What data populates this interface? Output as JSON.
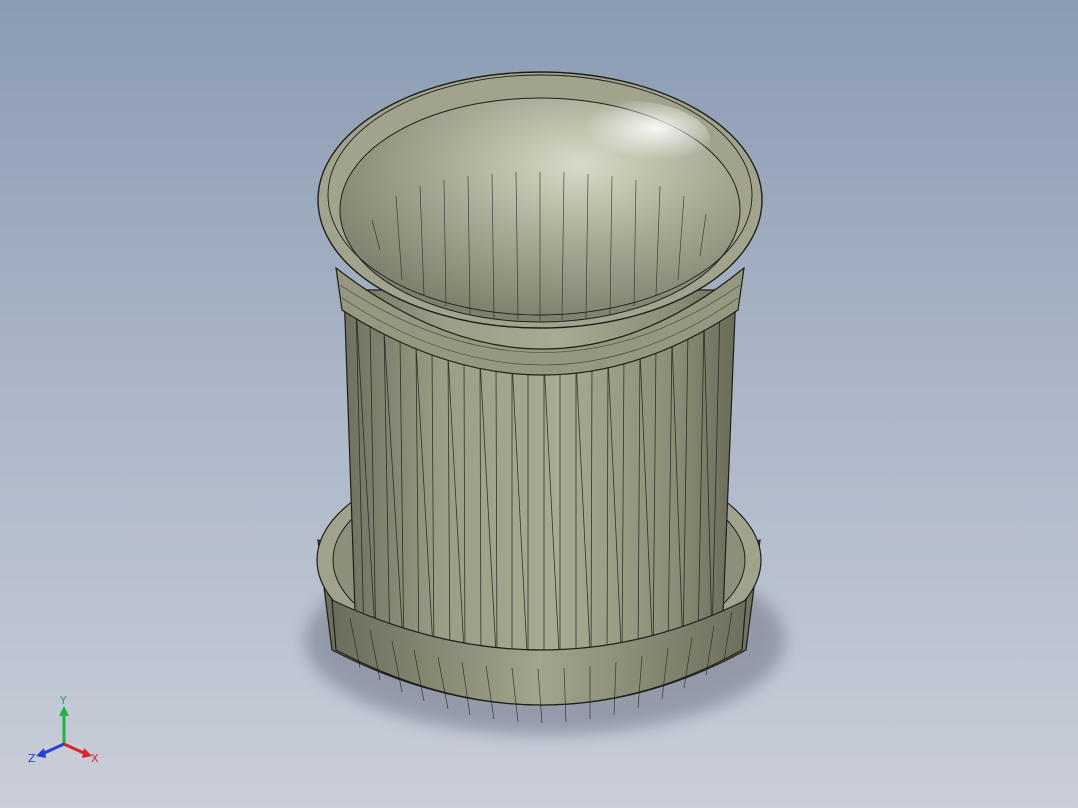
{
  "viewport": {
    "background_top": "#8a9bb2",
    "background_bottom": "#c9ced8"
  },
  "model": {
    "description_icon": "cylindrical-cup-mesh",
    "face_color": "#a4a58e",
    "edge_color": "#1e1f1a"
  },
  "triad": {
    "x_label": "X",
    "y_label": "Y",
    "z_label": "Z",
    "x_color": "#e0242c",
    "y_color": "#1fb24a",
    "z_color": "#2a3ed8"
  }
}
